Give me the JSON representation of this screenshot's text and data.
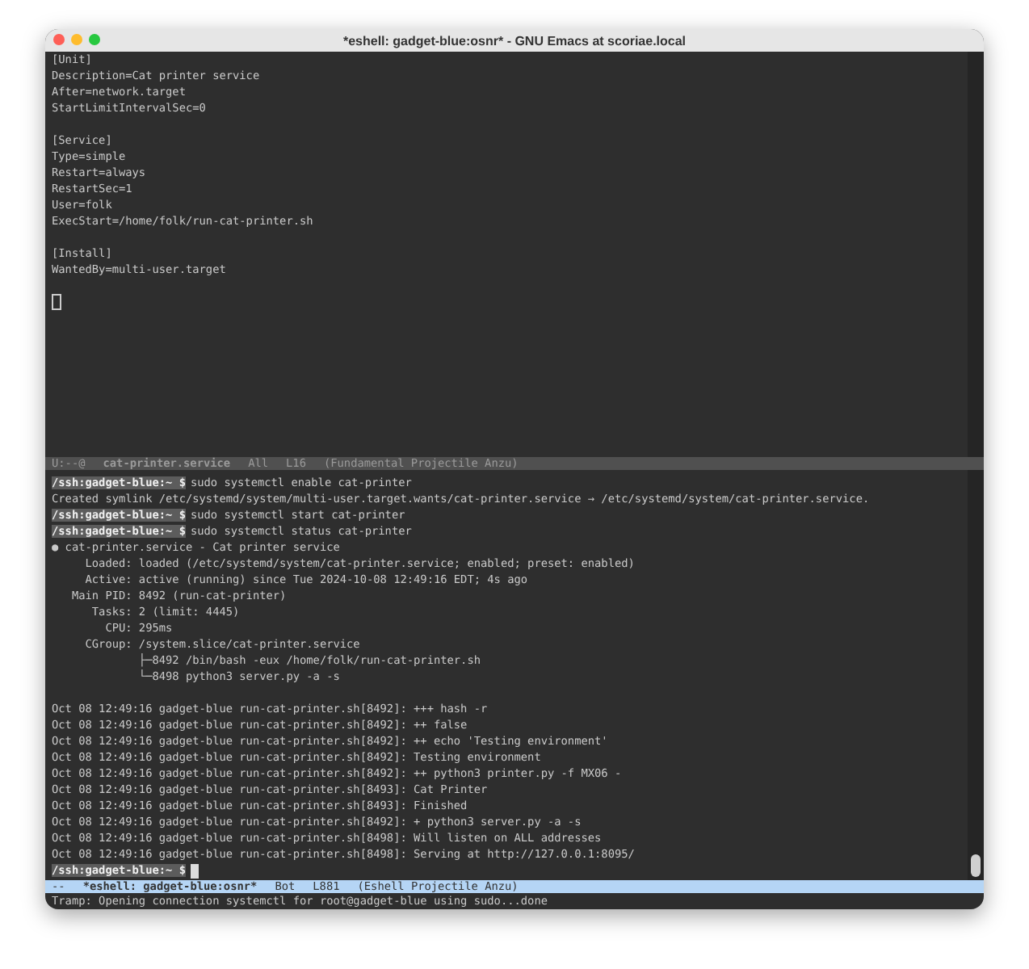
{
  "window": {
    "title": "*eshell: gadget-blue:osnr* - GNU Emacs at scoriae.local"
  },
  "top_buffer": {
    "lines": [
      {
        "kind": "text",
        "text": "[Unit]"
      },
      {
        "kind": "text",
        "text": "Description=Cat printer service"
      },
      {
        "kind": "text",
        "text": "After=network.target"
      },
      {
        "kind": "text",
        "text": "StartLimitIntervalSec=0"
      },
      {
        "kind": "blank"
      },
      {
        "kind": "text",
        "text": "[Service]"
      },
      {
        "kind": "text",
        "text": "Type=simple"
      },
      {
        "kind": "text",
        "text": "Restart=always"
      },
      {
        "kind": "text",
        "text": "RestartSec=1"
      },
      {
        "kind": "text",
        "text": "User=folk"
      },
      {
        "kind": "text",
        "text": "ExecStart=/home/folk/run-cat-printer.sh"
      },
      {
        "kind": "blank"
      },
      {
        "kind": "text",
        "text": "[Install]"
      },
      {
        "kind": "text",
        "text": "WantedBy=multi-user.target"
      },
      {
        "kind": "blank"
      },
      {
        "kind": "cursor"
      }
    ]
  },
  "top_mode_line": {
    "active": false,
    "fields": [
      "U:--@",
      "cat-printer.service",
      "All",
      "L16",
      "(Fundamental Projectile Anzu)"
    ]
  },
  "eshell": {
    "lines": [
      {
        "kind": "command",
        "prompt": "/ssh:gadget-blue:~ $",
        "text": "sudo systemctl enable cat-printer"
      },
      {
        "kind": "output",
        "text": "Created symlink /etc/systemd/system/multi-user.target.wants/cat-printer.service → /etc/systemd/system/cat-printer.service."
      },
      {
        "kind": "command",
        "prompt": "/ssh:gadget-blue:~ $",
        "text": "sudo systemctl start cat-printer"
      },
      {
        "kind": "command",
        "prompt": "/ssh:gadget-blue:~ $",
        "text": "sudo systemctl status cat-printer"
      },
      {
        "kind": "output",
        "text": "● cat-printer.service - Cat printer service"
      },
      {
        "kind": "output",
        "text": "     Loaded: loaded (/etc/systemd/system/cat-printer.service; enabled; preset: enabled)"
      },
      {
        "kind": "output",
        "text": "     Active: active (running) since Tue 2024-10-08 12:49:16 EDT; 4s ago"
      },
      {
        "kind": "output",
        "text": "   Main PID: 8492 (run-cat-printer)"
      },
      {
        "kind": "output",
        "text": "      Tasks: 2 (limit: 4445)"
      },
      {
        "kind": "output",
        "text": "        CPU: 295ms"
      },
      {
        "kind": "output",
        "text": "     CGroup: /system.slice/cat-printer.service"
      },
      {
        "kind": "output",
        "text": "             ├─8492 /bin/bash -eux /home/folk/run-cat-printer.sh"
      },
      {
        "kind": "output",
        "text": "             └─8498 python3 server.py -a -s"
      },
      {
        "kind": "blank"
      },
      {
        "kind": "output",
        "text": "Oct 08 12:49:16 gadget-blue run-cat-printer.sh[8492]: +++ hash -r"
      },
      {
        "kind": "output",
        "text": "Oct 08 12:49:16 gadget-blue run-cat-printer.sh[8492]: ++ false"
      },
      {
        "kind": "output",
        "text": "Oct 08 12:49:16 gadget-blue run-cat-printer.sh[8492]: ++ echo 'Testing environment'"
      },
      {
        "kind": "output",
        "text": "Oct 08 12:49:16 gadget-blue run-cat-printer.sh[8492]: Testing environment"
      },
      {
        "kind": "output",
        "text": "Oct 08 12:49:16 gadget-blue run-cat-printer.sh[8492]: ++ python3 printer.py -f MX06 -"
      },
      {
        "kind": "output",
        "text": "Oct 08 12:49:16 gadget-blue run-cat-printer.sh[8493]: Cat Printer"
      },
      {
        "kind": "output",
        "text": "Oct 08 12:49:16 gadget-blue run-cat-printer.sh[8493]: Finished"
      },
      {
        "kind": "output",
        "text": "Oct 08 12:49:16 gadget-blue run-cat-printer.sh[8492]: + python3 server.py -a -s"
      },
      {
        "kind": "output",
        "text": "Oct 08 12:49:16 gadget-blue run-cat-printer.sh[8498]: Will listen on ALL addresses"
      },
      {
        "kind": "output",
        "text": "Oct 08 12:49:16 gadget-blue run-cat-printer.sh[8498]: Serving at http://127.0.0.1:8095/"
      },
      {
        "kind": "prompt",
        "prompt": "/ssh:gadget-blue:~ $"
      }
    ]
  },
  "bottom_mode_line": {
    "active": true,
    "fields": [
      "--",
      "*eshell: gadget-blue:osnr*",
      "Bot",
      "L881",
      "(Eshell Projectile Anzu)"
    ]
  },
  "echo_area": {
    "text": "Tramp: Opening connection systemctl for root@gadget-blue using sudo...done"
  }
}
